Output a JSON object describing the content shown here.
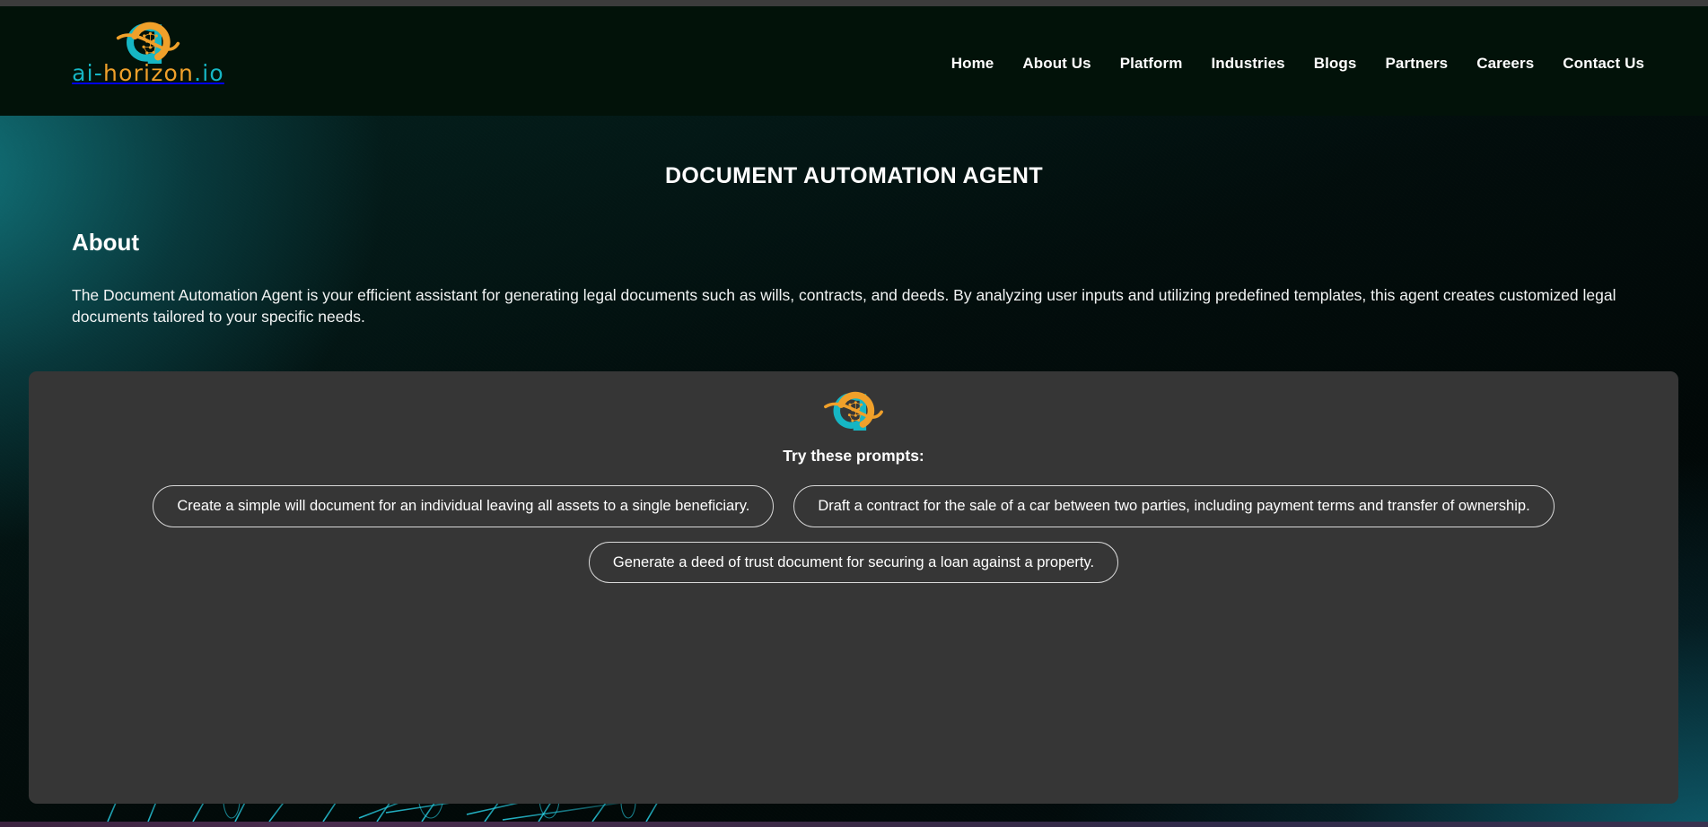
{
  "brand": {
    "logo_text_part1": "ai-",
    "logo_text_part2": "horizon",
    "logo_text_part3": ".io",
    "logo_alt": "ai-horizon.io",
    "accent_teal": "#16b6c4",
    "accent_orange": "#f0a02a"
  },
  "nav": {
    "items": [
      {
        "label": "Home"
      },
      {
        "label": "About Us"
      },
      {
        "label": "Platform"
      },
      {
        "label": "Industries"
      },
      {
        "label": "Blogs"
      },
      {
        "label": "Partners"
      },
      {
        "label": "Careers"
      },
      {
        "label": "Contact Us"
      }
    ]
  },
  "hero": {
    "title": "DOCUMENT AUTOMATION AGENT"
  },
  "about": {
    "heading": "About",
    "body": "The Document Automation Agent is your efficient assistant for generating legal documents such as wills, contracts, and deeds. By analyzing user inputs and utilizing predefined templates, this agent creates customized legal documents tailored to your specific needs."
  },
  "prompt_card": {
    "subtitle": "Try these prompts:",
    "background": "#363636",
    "prompts": [
      {
        "label": "Create a simple will document for an individual leaving all assets to a single beneficiary."
      },
      {
        "label": "Draft a contract for the sale of a car between two parties, including payment terms and transfer of ownership."
      },
      {
        "label": "Generate a deed of trust document for securing a loan against a property."
      }
    ]
  }
}
